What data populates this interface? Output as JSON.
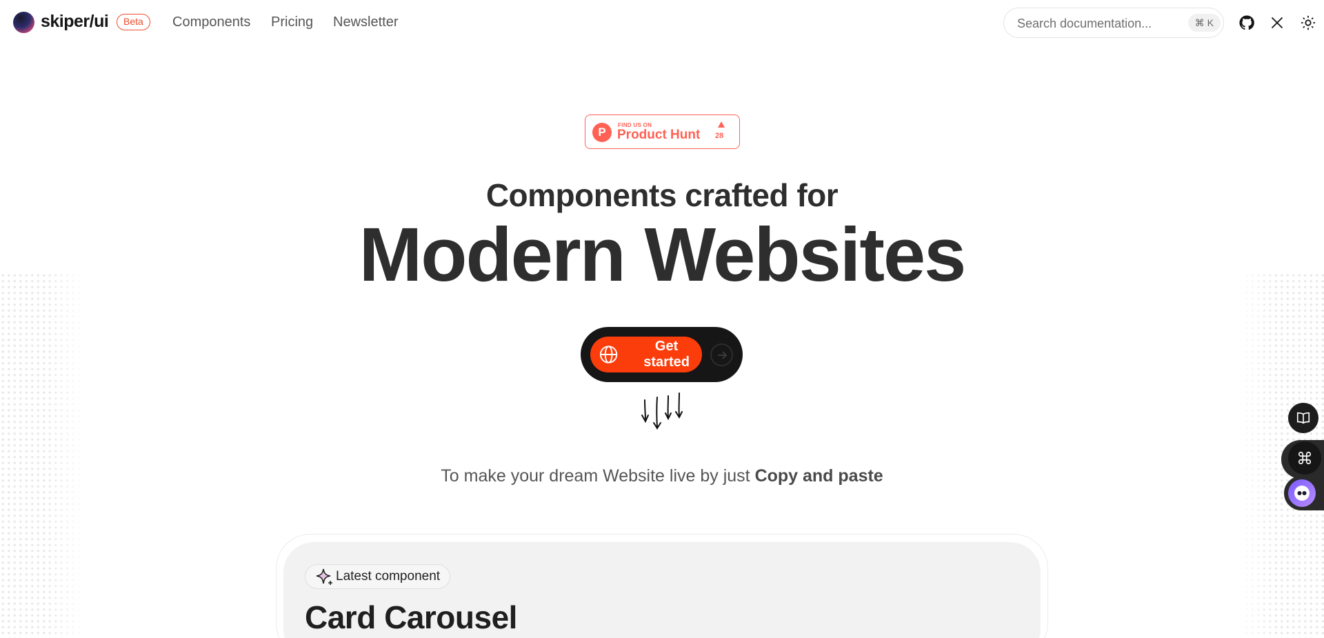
{
  "header": {
    "logo_text": "skiper/ui",
    "beta_label": "Beta",
    "nav": [
      "Components",
      "Pricing",
      "Newsletter"
    ],
    "search_placeholder": "Search documentation...",
    "search_shortcut": "⌘ K",
    "icons": [
      "github-icon",
      "x-icon",
      "sun-icon"
    ]
  },
  "product_hunt": {
    "small_text": "FIND US ON",
    "big_text": "Product Hunt",
    "letter": "P",
    "upvotes": "28",
    "color": "#ff6154"
  },
  "hero": {
    "subtitle": "Components crafted for",
    "title": "Modern Websites",
    "cta_label": "Get started",
    "tagline_prefix": "To make your dream Website live by just ",
    "tagline_bold": "Copy and paste"
  },
  "latest": {
    "pill_label": "Latest component",
    "title": "Card Carousel"
  },
  "colors": {
    "accent": "#fb3d0c",
    "beta": "#ef4b2b",
    "dark": "#161616"
  },
  "floating_rail": [
    "book-icon",
    "command-icon",
    "bot-icon"
  ]
}
